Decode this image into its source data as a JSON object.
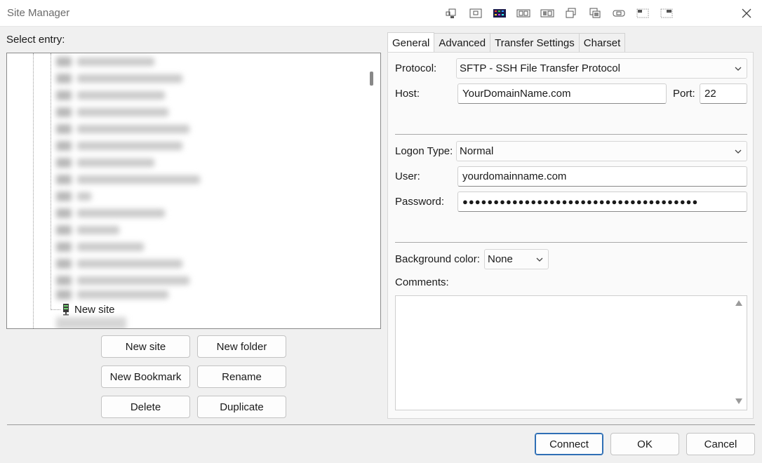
{
  "window": {
    "title": "Site Manager"
  },
  "toolbar_icons": [
    "dock-icon",
    "window-icon",
    "color-grid-icon",
    "panes-icon",
    "panes-alt-icon",
    "stack-icon",
    "stack-alt-icon",
    "gamepad-icon",
    "layout-top-icon",
    "layout-split-icon"
  ],
  "left": {
    "select_label": "Select entry:",
    "tree": {
      "visible_item": "New site"
    },
    "buttons": {
      "new_site": "New site",
      "new_folder": "New folder",
      "new_bookmark": "New Bookmark",
      "rename": "Rename",
      "delete": "Delete",
      "duplicate": "Duplicate"
    }
  },
  "tabs": [
    "General",
    "Advanced",
    "Transfer Settings",
    "Charset"
  ],
  "general": {
    "protocol_label": "Protocol:",
    "protocol_value": "SFTP - SSH File Transfer Protocol",
    "host_label": "Host:",
    "host_value": "YourDomainName.com",
    "port_label": "Port:",
    "port_value": "22",
    "logon_type_label": "Logon Type:",
    "logon_type_value": "Normal",
    "user_label": "User:",
    "user_value": "yourdomainname.com",
    "password_label": "Password:",
    "password_value": "●●●●●●●●●●●●●●●●●●●●●●●●●●●●●●●●●●●●●●",
    "bg_color_label": "Background color:",
    "bg_color_value": "None",
    "comments_label": "Comments:"
  },
  "footer": {
    "connect": "Connect",
    "ok": "OK",
    "cancel": "Cancel"
  },
  "colors": {
    "accent": "#2f6fb5"
  }
}
